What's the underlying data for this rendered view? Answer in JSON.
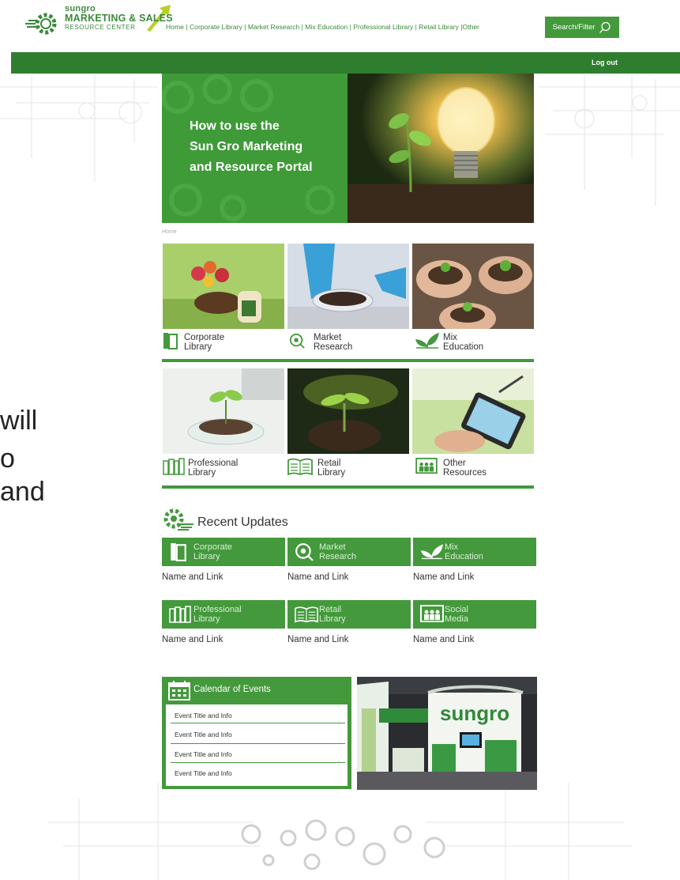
{
  "logo": {
    "brand_small": "sungro",
    "brand_main": "MARKETING & SALES",
    "brand_sub": "RESOURCE CENTER"
  },
  "nav": {
    "items": [
      "Home",
      "Corporate Library",
      "Market Research",
      "Mix Education",
      "Professional Library",
      "Retail Library",
      "Other"
    ],
    "search_label": "Search/Filter",
    "logout_label": "Log out"
  },
  "side_text": {
    "line1": "will",
    "line2": "o",
    "line3": "and"
  },
  "hero": {
    "line1": "How to use the",
    "line2": "Sun Gro Marketing",
    "line3": "and Resource Portal"
  },
  "breadcrumb": "Home",
  "tiles": [
    {
      "line1": "Corporate",
      "line2": "Library",
      "icon": "book-icon"
    },
    {
      "line1": "Market",
      "line2": "Research",
      "icon": "magnifier-icon"
    },
    {
      "line1": "Mix",
      "line2": "Education",
      "icon": "leaves-icon"
    },
    {
      "line1": "Professional",
      "line2": "Library",
      "icon": "bookshelf-icon"
    },
    {
      "line1": "Retail",
      "line2": "Library",
      "icon": "open-book-icon"
    },
    {
      "line1": "Other",
      "line2": "Resources",
      "icon": "people-board-icon"
    }
  ],
  "recent": {
    "title": "Recent Updates",
    "boxes": [
      {
        "line1": "Corporate",
        "line2": "Library",
        "link": "Name and Link"
      },
      {
        "line1": "Market",
        "line2": "Research",
        "link": "Name and Link"
      },
      {
        "line1": "Mix",
        "line2": "Education",
        "link": "Name and Link"
      },
      {
        "line1": "Professional",
        "line2": "Library",
        "link": "Name and Link"
      },
      {
        "line1": "Retail",
        "line2": "Library",
        "link": "Name and Link"
      },
      {
        "line1": "Social",
        "line2": "Media",
        "link": "Name and Link"
      }
    ]
  },
  "calendar": {
    "title": "Calendar of Events",
    "events": [
      "Event Title and Info",
      "Event Title and Info",
      "Event Title and Info",
      "Event Title and Info"
    ]
  },
  "booth": {
    "sign": "sungro"
  },
  "colors": {
    "brand_green": "#43993b",
    "dark_green": "#2f7d2f"
  }
}
